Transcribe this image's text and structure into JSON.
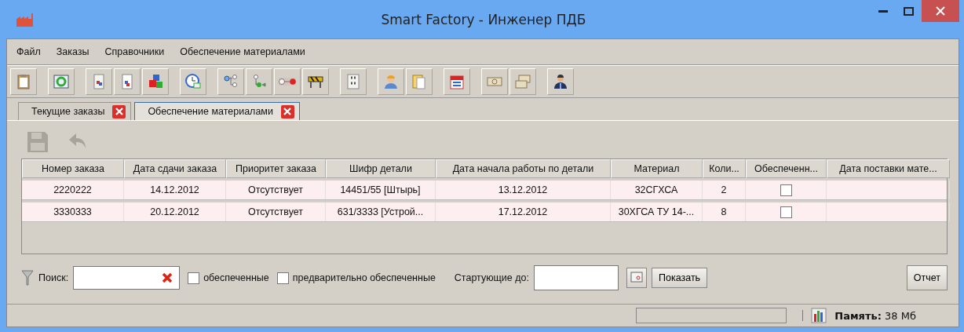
{
  "window": {
    "title": "Smart Factory - Инженер ПДБ"
  },
  "menu": [
    "Файл",
    "Заказы",
    "Справочники",
    "Обеспечение материалами"
  ],
  "tabs": [
    {
      "label": "Текущие заказы",
      "selected": false
    },
    {
      "label": "Обеспечение материалами",
      "selected": true
    }
  ],
  "edit_toolbar": [
    {
      "kind": "save",
      "disabled": true
    },
    {
      "kind": "undo",
      "disabled": true
    }
  ],
  "table": {
    "columns": [
      "Номер заказа",
      "Дата сдачи заказа",
      "Приоритет заказа",
      "Шифр детали",
      "Дата начала работы по детали",
      "Материал",
      "Коли...",
      "Обеспеченн...",
      "Дата поставки мате..."
    ],
    "rows": [
      {
        "cells": [
          "2220222",
          "14.12.2012",
          "Отсутствует",
          "14451/55 [Штырь]",
          "13.12.2012",
          "32СГХСА",
          "2"
        ],
        "provided": false
      },
      {
        "cells": [
          "3330333",
          "20.12.2012",
          "Отсутствует",
          "631/3333 [Устрой...",
          "17.12.2012",
          "30ХГСА ТУ 14-...",
          "8"
        ],
        "provided": false
      }
    ]
  },
  "filter": {
    "search_label": "Поиск:",
    "options": [
      {
        "label": "обеспеченные",
        "checked": false
      },
      {
        "label": "предварительно обеспеченные",
        "checked": false
      }
    ],
    "start_label": "Стартующие до:",
    "show_button": "Показать",
    "report_button": "Отчет"
  },
  "status_bar": {
    "memory_label": "Память:",
    "memory_value": "38 Мб"
  }
}
